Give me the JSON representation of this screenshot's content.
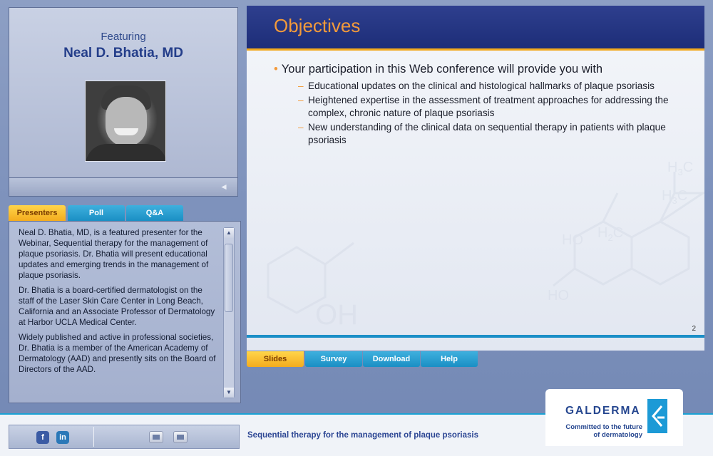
{
  "presenter": {
    "featuring_label": "Featuring",
    "name": "Neal D. Bhatia, MD"
  },
  "tabs_left": [
    {
      "label": "Presenters",
      "active": true
    },
    {
      "label": "Poll",
      "active": false
    },
    {
      "label": "Q&A",
      "active": false
    }
  ],
  "bio": {
    "paragraphs": [
      "Neal D. Bhatia, MD, is a featured presenter for the Webinar, Sequential therapy for the management of plaque psoriasis. Dr. Bhatia will present educational updates and emerging trends in the management of plaque psoriasis.",
      "Dr. Bhatia is a board-certified dermatologist on the staff of the Laser Skin Care Center in Long Beach, California and an Associate Professor of Dermatology at Harbor UCLA Medical Center.",
      "Widely published and active in professional societies, Dr. Bhatia is a member of the American Academy of Dermatology (AAD) and presently sits on the Board of Directors of the AAD."
    ]
  },
  "slide": {
    "title": "Objectives",
    "main_bullet": "Your participation in this Web conference will provide you with",
    "sub_bullets": [
      "Educational updates on the clinical and histological hallmarks of plaque psoriasis",
      "Heightened expertise in the assessment of treatment approaches for addressing the complex, chronic nature of plaque psoriasis",
      "New understanding of the clinical data on sequential therapy in patients with plaque psoriasis"
    ],
    "page_number": "2"
  },
  "tabs_bottom": [
    {
      "label": "Slides",
      "active": true
    },
    {
      "label": "Survey",
      "active": false
    },
    {
      "label": "Download",
      "active": false
    },
    {
      "label": "Help",
      "active": false
    }
  ],
  "footer": {
    "tagline": "Sequential therapy for the management of plaque psoriasis",
    "social": {
      "facebook": "f",
      "linkedin": "in"
    }
  },
  "logo": {
    "brand": "GALDERMA",
    "line1": "Committed to the future",
    "line2": "of dermatology"
  },
  "colors": {
    "accent_orange": "#f39a3a",
    "header_navy": "#1d2d78",
    "tab_blue": "#1a8fc4",
    "tab_active": "#f4ac1e"
  }
}
